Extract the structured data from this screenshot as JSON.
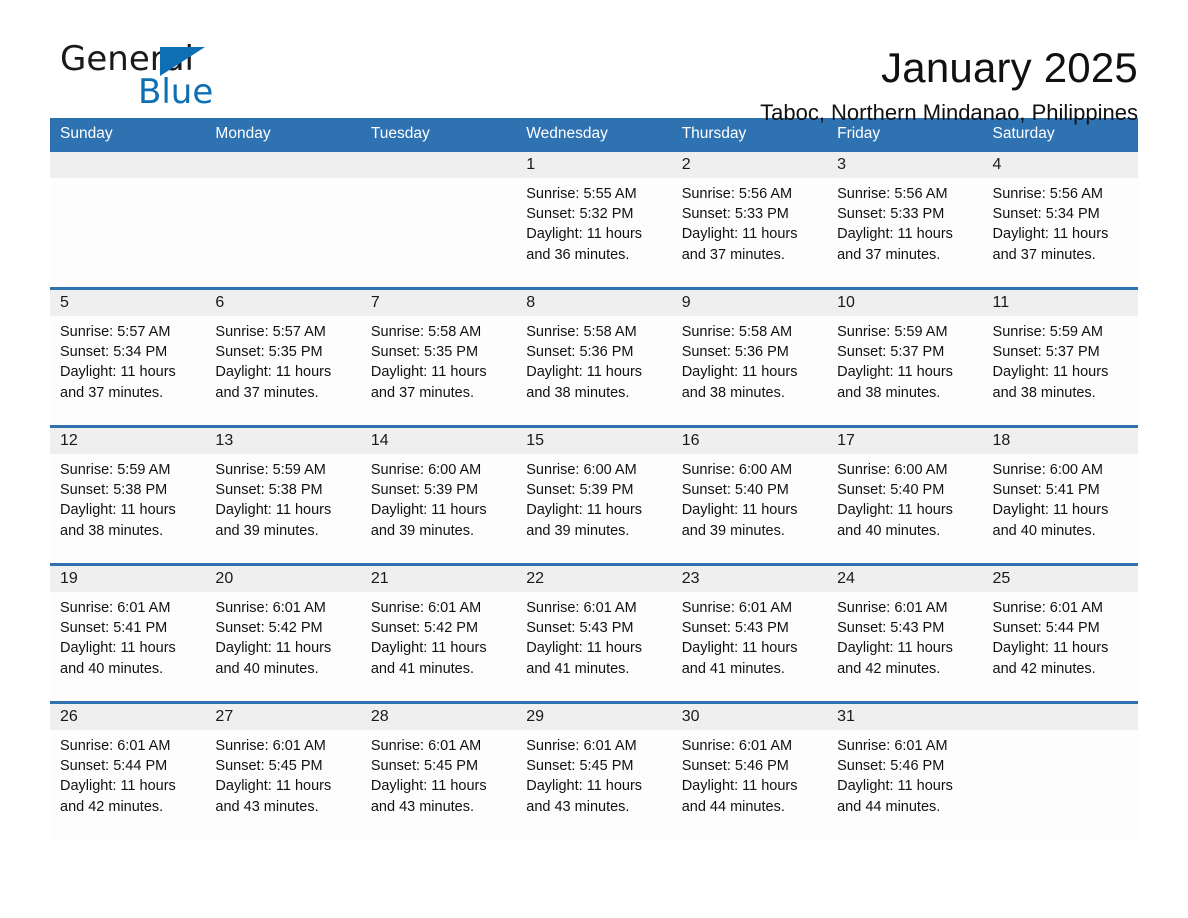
{
  "brand": {
    "name_part1": "General",
    "name_part2": "Blue",
    "accent_color": "#0f6fb5"
  },
  "header": {
    "title": "January 2025",
    "subtitle": "Taboc, Northern Mindanao, Philippines"
  },
  "calendar": {
    "header_bg": "#2e72b2",
    "day_band_bg": "#efefef",
    "weekdays": [
      "Sunday",
      "Monday",
      "Tuesday",
      "Wednesday",
      "Thursday",
      "Friday",
      "Saturday"
    ],
    "weeks": [
      [
        {
          "day": "",
          "sunrise": "",
          "sunset": "",
          "daylight_line1": "",
          "daylight_line2": ""
        },
        {
          "day": "",
          "sunrise": "",
          "sunset": "",
          "daylight_line1": "",
          "daylight_line2": ""
        },
        {
          "day": "",
          "sunrise": "",
          "sunset": "",
          "daylight_line1": "",
          "daylight_line2": ""
        },
        {
          "day": "1",
          "sunrise": "Sunrise: 5:55 AM",
          "sunset": "Sunset: 5:32 PM",
          "daylight_line1": "Daylight: 11 hours",
          "daylight_line2": "and 36 minutes."
        },
        {
          "day": "2",
          "sunrise": "Sunrise: 5:56 AM",
          "sunset": "Sunset: 5:33 PM",
          "daylight_line1": "Daylight: 11 hours",
          "daylight_line2": "and 37 minutes."
        },
        {
          "day": "3",
          "sunrise": "Sunrise: 5:56 AM",
          "sunset": "Sunset: 5:33 PM",
          "daylight_line1": "Daylight: 11 hours",
          "daylight_line2": "and 37 minutes."
        },
        {
          "day": "4",
          "sunrise": "Sunrise: 5:56 AM",
          "sunset": "Sunset: 5:34 PM",
          "daylight_line1": "Daylight: 11 hours",
          "daylight_line2": "and 37 minutes."
        }
      ],
      [
        {
          "day": "5",
          "sunrise": "Sunrise: 5:57 AM",
          "sunset": "Sunset: 5:34 PM",
          "daylight_line1": "Daylight: 11 hours",
          "daylight_line2": "and 37 minutes."
        },
        {
          "day": "6",
          "sunrise": "Sunrise: 5:57 AM",
          "sunset": "Sunset: 5:35 PM",
          "daylight_line1": "Daylight: 11 hours",
          "daylight_line2": "and 37 minutes."
        },
        {
          "day": "7",
          "sunrise": "Sunrise: 5:58 AM",
          "sunset": "Sunset: 5:35 PM",
          "daylight_line1": "Daylight: 11 hours",
          "daylight_line2": "and 37 minutes."
        },
        {
          "day": "8",
          "sunrise": "Sunrise: 5:58 AM",
          "sunset": "Sunset: 5:36 PM",
          "daylight_line1": "Daylight: 11 hours",
          "daylight_line2": "and 38 minutes."
        },
        {
          "day": "9",
          "sunrise": "Sunrise: 5:58 AM",
          "sunset": "Sunset: 5:36 PM",
          "daylight_line1": "Daylight: 11 hours",
          "daylight_line2": "and 38 minutes."
        },
        {
          "day": "10",
          "sunrise": "Sunrise: 5:59 AM",
          "sunset": "Sunset: 5:37 PM",
          "daylight_line1": "Daylight: 11 hours",
          "daylight_line2": "and 38 minutes."
        },
        {
          "day": "11",
          "sunrise": "Sunrise: 5:59 AM",
          "sunset": "Sunset: 5:37 PM",
          "daylight_line1": "Daylight: 11 hours",
          "daylight_line2": "and 38 minutes."
        }
      ],
      [
        {
          "day": "12",
          "sunrise": "Sunrise: 5:59 AM",
          "sunset": "Sunset: 5:38 PM",
          "daylight_line1": "Daylight: 11 hours",
          "daylight_line2": "and 38 minutes."
        },
        {
          "day": "13",
          "sunrise": "Sunrise: 5:59 AM",
          "sunset": "Sunset: 5:38 PM",
          "daylight_line1": "Daylight: 11 hours",
          "daylight_line2": "and 39 minutes."
        },
        {
          "day": "14",
          "sunrise": "Sunrise: 6:00 AM",
          "sunset": "Sunset: 5:39 PM",
          "daylight_line1": "Daylight: 11 hours",
          "daylight_line2": "and 39 minutes."
        },
        {
          "day": "15",
          "sunrise": "Sunrise: 6:00 AM",
          "sunset": "Sunset: 5:39 PM",
          "daylight_line1": "Daylight: 11 hours",
          "daylight_line2": "and 39 minutes."
        },
        {
          "day": "16",
          "sunrise": "Sunrise: 6:00 AM",
          "sunset": "Sunset: 5:40 PM",
          "daylight_line1": "Daylight: 11 hours",
          "daylight_line2": "and 39 minutes."
        },
        {
          "day": "17",
          "sunrise": "Sunrise: 6:00 AM",
          "sunset": "Sunset: 5:40 PM",
          "daylight_line1": "Daylight: 11 hours",
          "daylight_line2": "and 40 minutes."
        },
        {
          "day": "18",
          "sunrise": "Sunrise: 6:00 AM",
          "sunset": "Sunset: 5:41 PM",
          "daylight_line1": "Daylight: 11 hours",
          "daylight_line2": "and 40 minutes."
        }
      ],
      [
        {
          "day": "19",
          "sunrise": "Sunrise: 6:01 AM",
          "sunset": "Sunset: 5:41 PM",
          "daylight_line1": "Daylight: 11 hours",
          "daylight_line2": "and 40 minutes."
        },
        {
          "day": "20",
          "sunrise": "Sunrise: 6:01 AM",
          "sunset": "Sunset: 5:42 PM",
          "daylight_line1": "Daylight: 11 hours",
          "daylight_line2": "and 40 minutes."
        },
        {
          "day": "21",
          "sunrise": "Sunrise: 6:01 AM",
          "sunset": "Sunset: 5:42 PM",
          "daylight_line1": "Daylight: 11 hours",
          "daylight_line2": "and 41 minutes."
        },
        {
          "day": "22",
          "sunrise": "Sunrise: 6:01 AM",
          "sunset": "Sunset: 5:43 PM",
          "daylight_line1": "Daylight: 11 hours",
          "daylight_line2": "and 41 minutes."
        },
        {
          "day": "23",
          "sunrise": "Sunrise: 6:01 AM",
          "sunset": "Sunset: 5:43 PM",
          "daylight_line1": "Daylight: 11 hours",
          "daylight_line2": "and 41 minutes."
        },
        {
          "day": "24",
          "sunrise": "Sunrise: 6:01 AM",
          "sunset": "Sunset: 5:43 PM",
          "daylight_line1": "Daylight: 11 hours",
          "daylight_line2": "and 42 minutes."
        },
        {
          "day": "25",
          "sunrise": "Sunrise: 6:01 AM",
          "sunset": "Sunset: 5:44 PM",
          "daylight_line1": "Daylight: 11 hours",
          "daylight_line2": "and 42 minutes."
        }
      ],
      [
        {
          "day": "26",
          "sunrise": "Sunrise: 6:01 AM",
          "sunset": "Sunset: 5:44 PM",
          "daylight_line1": "Daylight: 11 hours",
          "daylight_line2": "and 42 minutes."
        },
        {
          "day": "27",
          "sunrise": "Sunrise: 6:01 AM",
          "sunset": "Sunset: 5:45 PM",
          "daylight_line1": "Daylight: 11 hours",
          "daylight_line2": "and 43 minutes."
        },
        {
          "day": "28",
          "sunrise": "Sunrise: 6:01 AM",
          "sunset": "Sunset: 5:45 PM",
          "daylight_line1": "Daylight: 11 hours",
          "daylight_line2": "and 43 minutes."
        },
        {
          "day": "29",
          "sunrise": "Sunrise: 6:01 AM",
          "sunset": "Sunset: 5:45 PM",
          "daylight_line1": "Daylight: 11 hours",
          "daylight_line2": "and 43 minutes."
        },
        {
          "day": "30",
          "sunrise": "Sunrise: 6:01 AM",
          "sunset": "Sunset: 5:46 PM",
          "daylight_line1": "Daylight: 11 hours",
          "daylight_line2": "and 44 minutes."
        },
        {
          "day": "31",
          "sunrise": "Sunrise: 6:01 AM",
          "sunset": "Sunset: 5:46 PM",
          "daylight_line1": "Daylight: 11 hours",
          "daylight_line2": "and 44 minutes."
        },
        {
          "day": "",
          "sunrise": "",
          "sunset": "",
          "daylight_line1": "",
          "daylight_line2": ""
        }
      ]
    ]
  }
}
